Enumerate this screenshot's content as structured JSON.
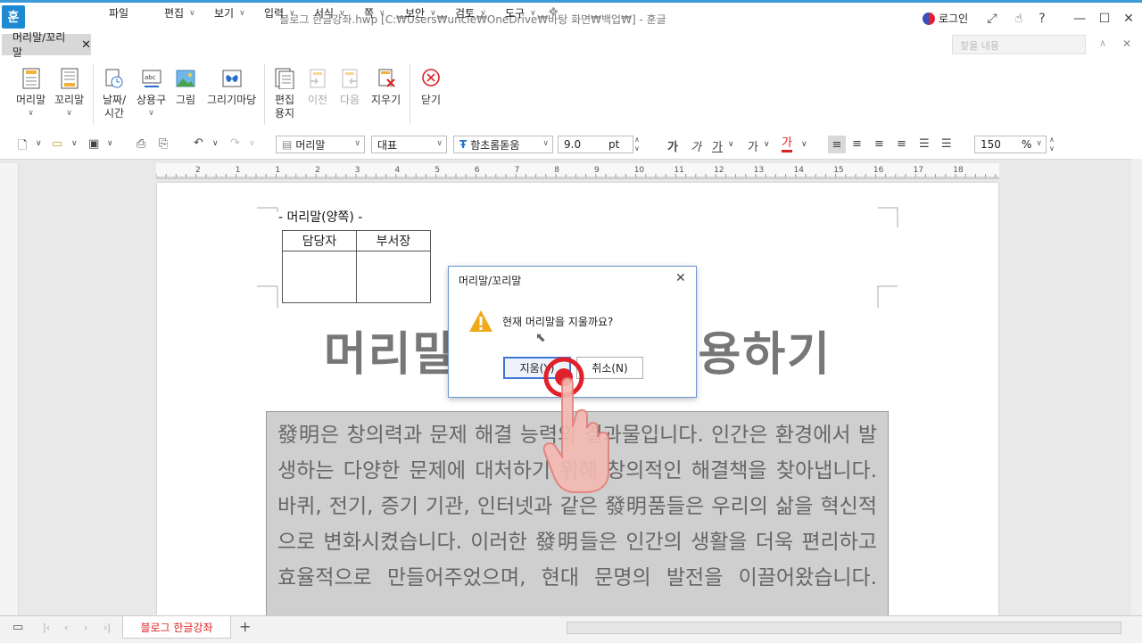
{
  "titlebar": {
    "app_logo": "훈",
    "title": "블로그 한글강좌.hwp [C:₩Users₩uncle₩OneDrive₩바탕 화면₩백업₩] - 훈글",
    "login": "로그인",
    "help": "?"
  },
  "menubar": {
    "active_tab": "머리말/꼬리말",
    "file": "파일",
    "items": [
      "편집",
      "보기",
      "입력",
      "서식",
      "쪽",
      "보안",
      "검토",
      "도구"
    ],
    "find_placeholder": "찾을 내용"
  },
  "ribbon": {
    "header": [
      "머리말"
    ],
    "footer": [
      "꼬리말"
    ],
    "datetime": [
      "날짜/",
      "시간"
    ],
    "phrase": [
      "상용구"
    ],
    "picture": [
      "그림"
    ],
    "drawing": [
      "그리기마당"
    ],
    "edit_paper": [
      "편집",
      "용지"
    ],
    "prev": [
      "이전"
    ],
    "next": [
      "다음"
    ],
    "erase": [
      "지우기"
    ],
    "close": [
      "닫기"
    ]
  },
  "format_bar": {
    "style": "머리말",
    "lang": "대표",
    "font": "함초롬돋움",
    "size": "9.0",
    "unit": "pt",
    "zoom": "150",
    "zoom_unit": "%",
    "text_icons": [
      "가",
      "가",
      "가",
      "가",
      "가"
    ]
  },
  "ruler": {
    "labels": [
      "2",
      "1",
      "1",
      "2",
      "3",
      "4",
      "5",
      "6",
      "7",
      "8",
      "9",
      "10",
      "11",
      "12",
      "13",
      "14",
      "15",
      "16",
      "17",
      "18"
    ]
  },
  "document": {
    "header_label": "- 머리말(양쪽) -",
    "table_headers": [
      "담당자",
      "부서장"
    ],
    "big_title_left": "머리말",
    "big_title_right": "용하기",
    "body": "發明은 창의력과 문제 해결 능력의 결과물입니다. 인간은 환경에서 발생하는 다양한 문제에 대처하기 위해 창의적인 해결책을 찾아냅니다. 바퀴, 전기, 증기 기관, 인터넷과 같은 發明품들은 우리의 삶을 혁신적으로 변화시켰습니다. 이러한 發明들은 인간의 생활을 더욱 편리하고 효율적으로 만들어주었으며, 현대 문명의 발전을 이끌어왔습니다."
  },
  "dialog": {
    "title": "머리말/꼬리말",
    "message": "현재 머리말을 지울까요?",
    "yes": "지움(Y)",
    "no": "취소(N)"
  },
  "bottombar": {
    "doc_tab": "블로그 한글강좌",
    "add": "+"
  },
  "colors": {
    "accent": "#3c9ad6",
    "dialog_border": "#6b95d3",
    "click_ring": "#e0202a",
    "warning": "#f0a81c"
  }
}
